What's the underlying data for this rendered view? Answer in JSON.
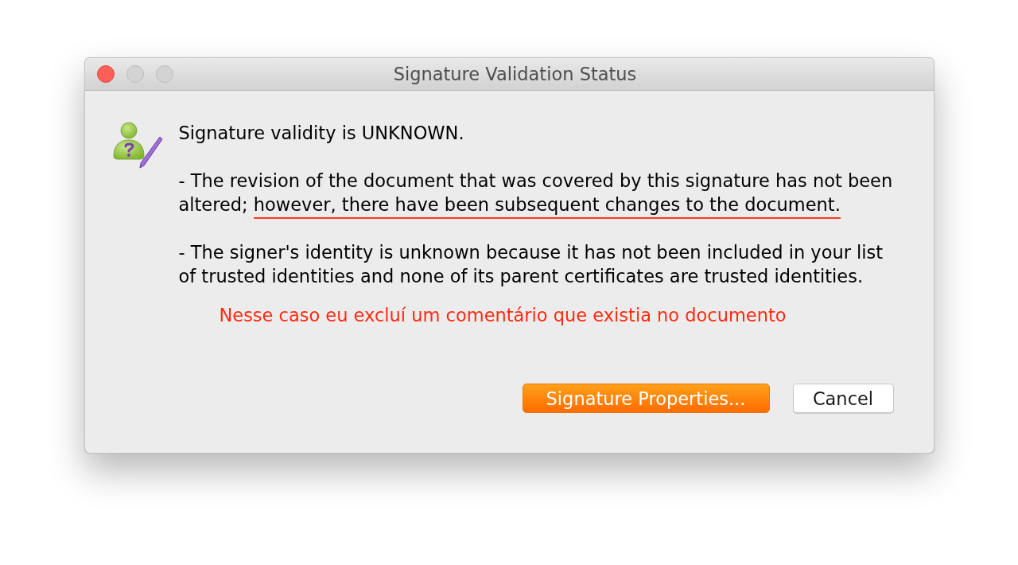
{
  "window": {
    "title": "Signature Validation Status",
    "window_buttons": [
      {
        "kind": "close",
        "disabled": false
      },
      {
        "kind": "minimize",
        "disabled": true
      },
      {
        "kind": "zoom",
        "disabled": true
      }
    ]
  },
  "message": {
    "status": "Signature validity is UNKNOWN.",
    "details": [
      {
        "segments": [
          {
            "text": "- The revision of the document that was covered by this signature has not been altered; ",
            "underlined": false
          },
          {
            "text": "however, there have been subsequent changes to the document.",
            "underlined": true
          }
        ]
      },
      {
        "segments": [
          {
            "text": "- The signer's identity is unknown because it has not been included in your list of trusted identities and none of its parent certificates are trusted identities.",
            "underlined": false
          }
        ]
      }
    ]
  },
  "annotation": {
    "note": "Nesse caso eu excluí um comentário que existia no documento"
  },
  "buttons": [
    {
      "label": "Signature Properties...",
      "default": true
    },
    {
      "label": "Cancel",
      "default": false
    }
  ]
}
